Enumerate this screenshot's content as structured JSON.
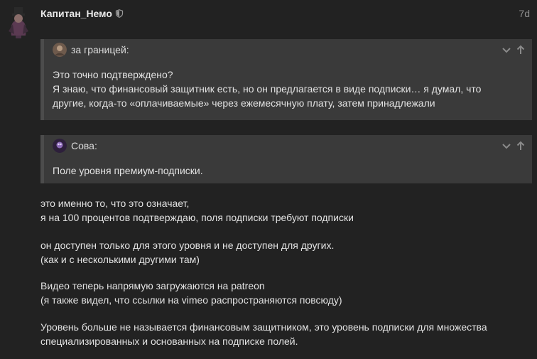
{
  "post": {
    "username": "Капитан_Немо",
    "time": "7d",
    "badge_icon": "shield-icon"
  },
  "quotes": [
    {
      "author": "за границей:",
      "lines": [
        "Это точно подтверждено?",
        "Я знаю, что финансовый защитник есть, но он предлагается в виде подписки… я думал, что",
        "другие, когда-то «оплачиваемые» через ежемесячную плату, затем принадлежали"
      ]
    },
    {
      "author": "Сова:",
      "lines": [
        "Поле уровня премиум-подписки."
      ]
    }
  ],
  "body": [
    [
      "это именно то, что это означает,",
      "я на 100 процентов подтверждаю, поля подписки требуют подписки"
    ],
    [
      "он доступен только для этого уровня и не доступен для других.",
      "(как и с несколькими другими там)"
    ],
    [
      "Видео теперь напрямую загружаются на patreon",
      "(я также видел, что ссылки на vimeo распространяются повсюду)"
    ],
    [
      "Уровень больше не называется финансовым защитником, это уровень подписки для множества",
      "специализированных и основанных на подписке полей."
    ]
  ],
  "colors": {
    "background": "#222222",
    "quote_bg": "#3a3a3a",
    "quote_border": "#4c4c4c",
    "text": "#e2e2e2",
    "muted": "#8e8e8e"
  }
}
